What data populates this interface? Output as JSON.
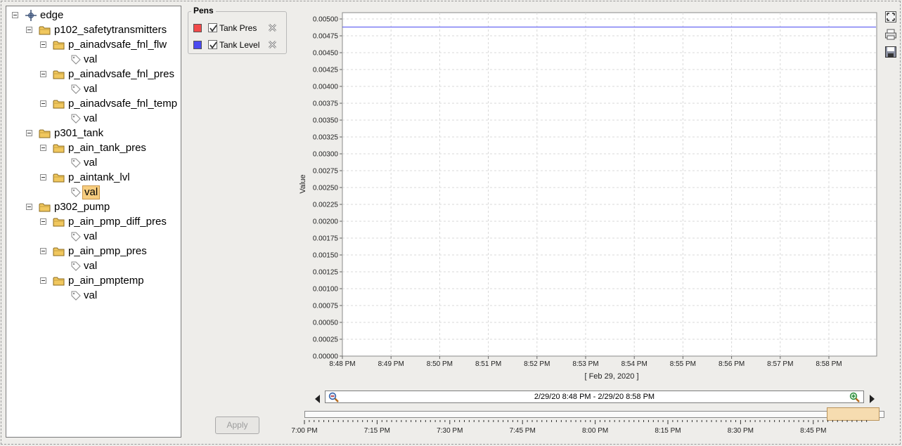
{
  "tree": {
    "root": "edge",
    "nodes": [
      {
        "label": "p102_safetytransmitters",
        "children": [
          {
            "label": "p_ainadvsafe_fnl_flw",
            "tag": "val"
          },
          {
            "label": "p_ainadvsafe_fnl_pres",
            "tag": "val"
          },
          {
            "label": "p_ainadvsafe_fnl_temp",
            "tag": "val"
          }
        ]
      },
      {
        "label": "p301_tank",
        "children": [
          {
            "label": "p_ain_tank_pres",
            "tag": "val"
          },
          {
            "label": "p_aintank_lvl",
            "tag": "val",
            "selected": true
          }
        ]
      },
      {
        "label": "p302_pump",
        "children": [
          {
            "label": "p_ain_pmp_diff_pres",
            "tag": "val"
          },
          {
            "label": "p_ain_pmp_pres",
            "tag": "val"
          },
          {
            "label": "p_ain_pmptemp",
            "tag": "val"
          }
        ]
      }
    ]
  },
  "pens": {
    "title": "Pens",
    "items": [
      {
        "name": "Tank Pres",
        "color": "#f24a4a",
        "checked": true
      },
      {
        "name": "Tank Level",
        "color": "#4a4af0",
        "checked": true
      }
    ]
  },
  "apply_label": "Apply",
  "chart_data": {
    "type": "line",
    "ylabel": "Value",
    "xlabel": "[ Feb 29, 2020 ]",
    "ylim": [
      0,
      0.005
    ],
    "y_ticks": [
      "0.00500",
      "0.00475",
      "0.00450",
      "0.00425",
      "0.00400",
      "0.00375",
      "0.00350",
      "0.00325",
      "0.00300",
      "0.00275",
      "0.00250",
      "0.00225",
      "0.00200",
      "0.00175",
      "0.00150",
      "0.00125",
      "0.00100",
      "0.00075",
      "0.00050",
      "0.00025",
      "0.00000"
    ],
    "x_ticks": [
      "8:48 PM",
      "8:49 PM",
      "8:50 PM",
      "8:51 PM",
      "8:52 PM",
      "8:53 PM",
      "8:54 PM",
      "8:55 PM",
      "8:56 PM",
      "8:57 PM",
      "8:58 PM"
    ],
    "grid": true,
    "series": [
      {
        "name": "Tank Level",
        "color": "#4a4af0",
        "x": [
          "8:48 PM",
          "8:58 PM"
        ],
        "values": [
          0.00488,
          0.00488
        ]
      }
    ]
  },
  "range": {
    "text": "2/29/20 8:48 PM - 2/29/20 8:58 PM"
  },
  "overview": {
    "ticks": [
      "7:00 PM",
      "7:15 PM",
      "7:30 PM",
      "7:45 PM",
      "8:00 PM",
      "8:15 PM",
      "8:30 PM",
      "8:45 PM"
    ]
  },
  "icons": {
    "fullscreen": "fullscreen-icon",
    "print": "print-icon",
    "save": "save-icon"
  }
}
